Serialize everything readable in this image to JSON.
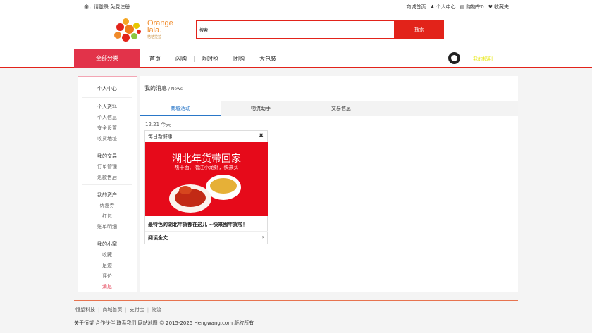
{
  "topbar": {
    "greeting": "亲，请登录 免费注册",
    "links": [
      "商城首页",
      "个人中心",
      "购物车0",
      "收藏夹"
    ]
  },
  "logo": {
    "line1": "Orange",
    "line2": "lala.",
    "line3": "桔桔拉拉"
  },
  "search": {
    "placeholder": "搜索",
    "button": "搜索"
  },
  "nav": {
    "all_categories": "全部分类",
    "items": [
      "首页",
      "闪购",
      "限时抢",
      "团购",
      "大包装"
    ],
    "mine": "我的福利"
  },
  "sidebar": {
    "personal_center": "个人中心",
    "groups": [
      {
        "heading": "个人资料",
        "items": [
          "个人信息",
          "安全设置",
          "收货地址"
        ]
      },
      {
        "heading": "我的交易",
        "items": [
          "订单管理",
          "退款售后"
        ]
      },
      {
        "heading": "我的资产",
        "items": [
          "优惠券",
          "红包",
          "账单明细"
        ]
      },
      {
        "heading": "我的小窝",
        "items": [
          "收藏",
          "足迹",
          "评价",
          "消息"
        ]
      }
    ]
  },
  "main": {
    "title": "我的消息",
    "title_suffix": " / News",
    "tabs": [
      "商城活动",
      "物流助手",
      "交易信息"
    ],
    "date": "12.21 今天",
    "card": {
      "header": "每日新鲜事",
      "headline": "湖北年货带回家",
      "subline": "热干面、潜江小龙虾，快来买",
      "caption": "最特色的湖北年货都在这儿 ~快来囤年货啦！",
      "read_more": "阅读全文"
    }
  },
  "footer": {
    "links": [
      "恒望科技",
      "商城首页",
      "支付宝",
      "物流"
    ],
    "copyright": "关于恒望 合作伙伴 联系我们 网站地图 © 2015-2025 Hengwang.com 版权所有"
  },
  "colors": {
    "brand_red": "#e2231a",
    "accent_blue": "#2a77c8",
    "active_pink": "#e2334a"
  }
}
